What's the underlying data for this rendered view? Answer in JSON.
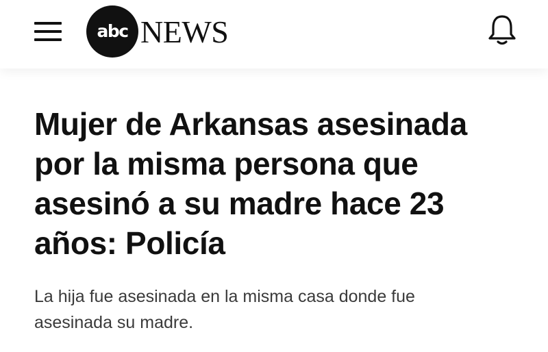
{
  "header": {
    "logo_mark": "abc",
    "logo_text": "NEWS",
    "menu_icon": "hamburger-menu-icon",
    "bell_icon": "bell-icon"
  },
  "article": {
    "headline": "Mujer de Arkansas asesinada por la misma persona que asesinó a su madre hace 23 años: Policía",
    "subheadline": "La hija fue asesinada en la misma casa donde fue asesinada su madre."
  },
  "colors": {
    "text": "#111111",
    "subtext": "#3a3a3a",
    "background": "#ffffff"
  }
}
